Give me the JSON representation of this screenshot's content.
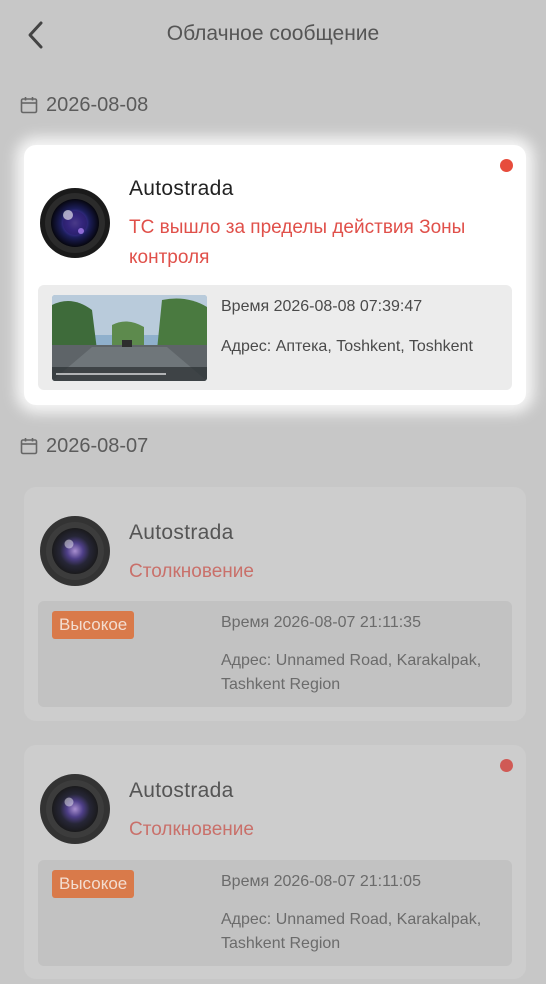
{
  "header": {
    "title": "Облачное сообщение"
  },
  "colors": {
    "unread": "#e74c3c",
    "accent_text": "#e0504a",
    "badge": "#d97a4a"
  },
  "groups": [
    {
      "date": "2026-08-08",
      "items": [
        {
          "device": "Autostrada",
          "message": "ТС вышло за пределы действия Зоны контроля",
          "time": "Время 2026-08-08 07:39:47",
          "address": "Адрес: Аптека, Toshkent, Toshkent",
          "has_thumbnail": true,
          "unread": true
        }
      ]
    },
    {
      "date": "2026-08-07",
      "items": [
        {
          "device": "Autostrada",
          "message": "Столкновение",
          "badge": "Высокое",
          "time": "Время 2026-08-07 21:11:35",
          "address": "Адрес: Unnamed Road, Karakalpak, Tashkent Region",
          "unread": false
        },
        {
          "device": "Autostrada",
          "message": "Столкновение",
          "badge": "Высокое",
          "time": "Время 2026-08-07 21:11:05",
          "address": "Адрес: Unnamed Road, Karakalpak, Tashkent Region",
          "unread": true
        }
      ]
    }
  ]
}
